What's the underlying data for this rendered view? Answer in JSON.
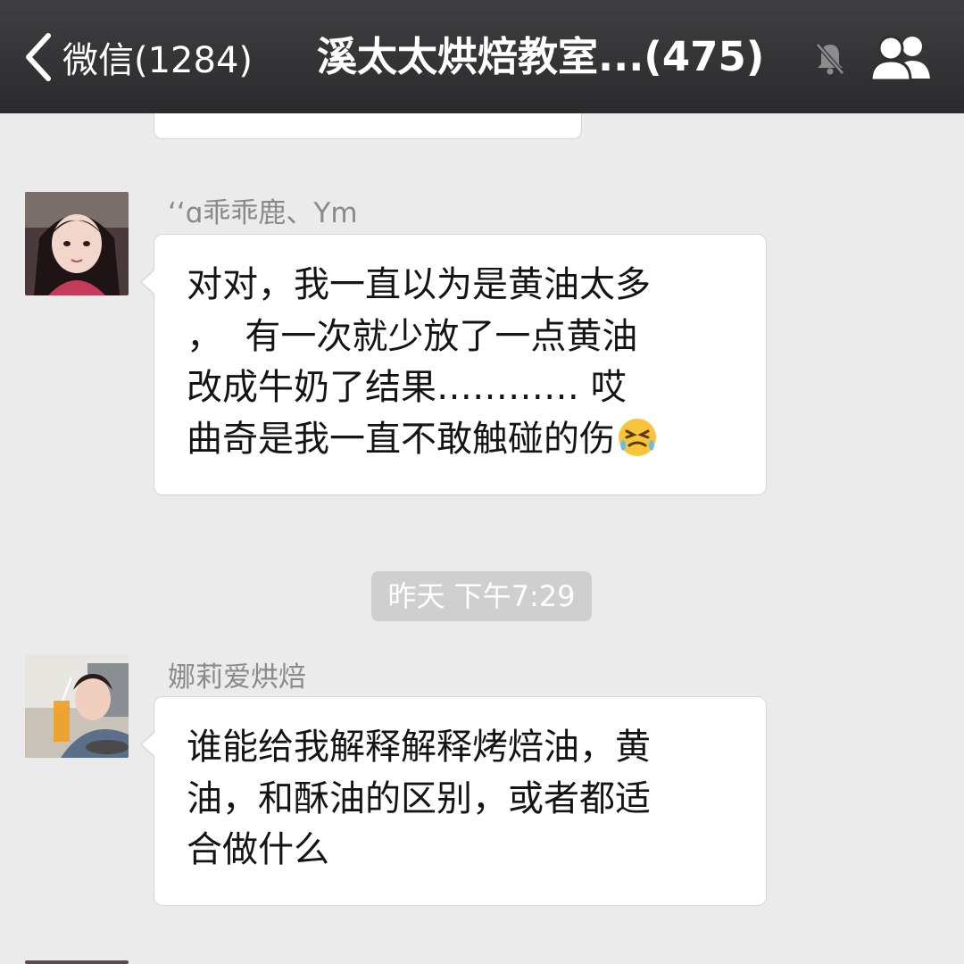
{
  "nav": {
    "back_label": "微信(1284)",
    "title": "溪太太烘焙教室...(475)"
  },
  "messages": [
    {
      "sender": "‘‘ɑ乖乖鹿、Ym",
      "text": "对对，我一直以为是黄油太多\n，  有一次就少放了一点黄油\n改成牛奶了结果………… 哎\n曲奇是我一直不敢触碰的伤",
      "emoji": "crying-face"
    },
    {
      "sender": "娜莉爱烘焙",
      "text": "谁能给我解释解释烤焙油，黄\n油，和酥油的区别，或者都适\n合做什么"
    }
  ],
  "timestamp": "昨天 下午7:29",
  "icons": {
    "back": "chevron-left-icon",
    "mute": "bell-muted-icon",
    "members": "group-icon"
  },
  "colors": {
    "navbar": "#333335",
    "background": "#ebebeb",
    "bubble": "#ffffff",
    "timestamp_bg": "#cfcfcf"
  }
}
